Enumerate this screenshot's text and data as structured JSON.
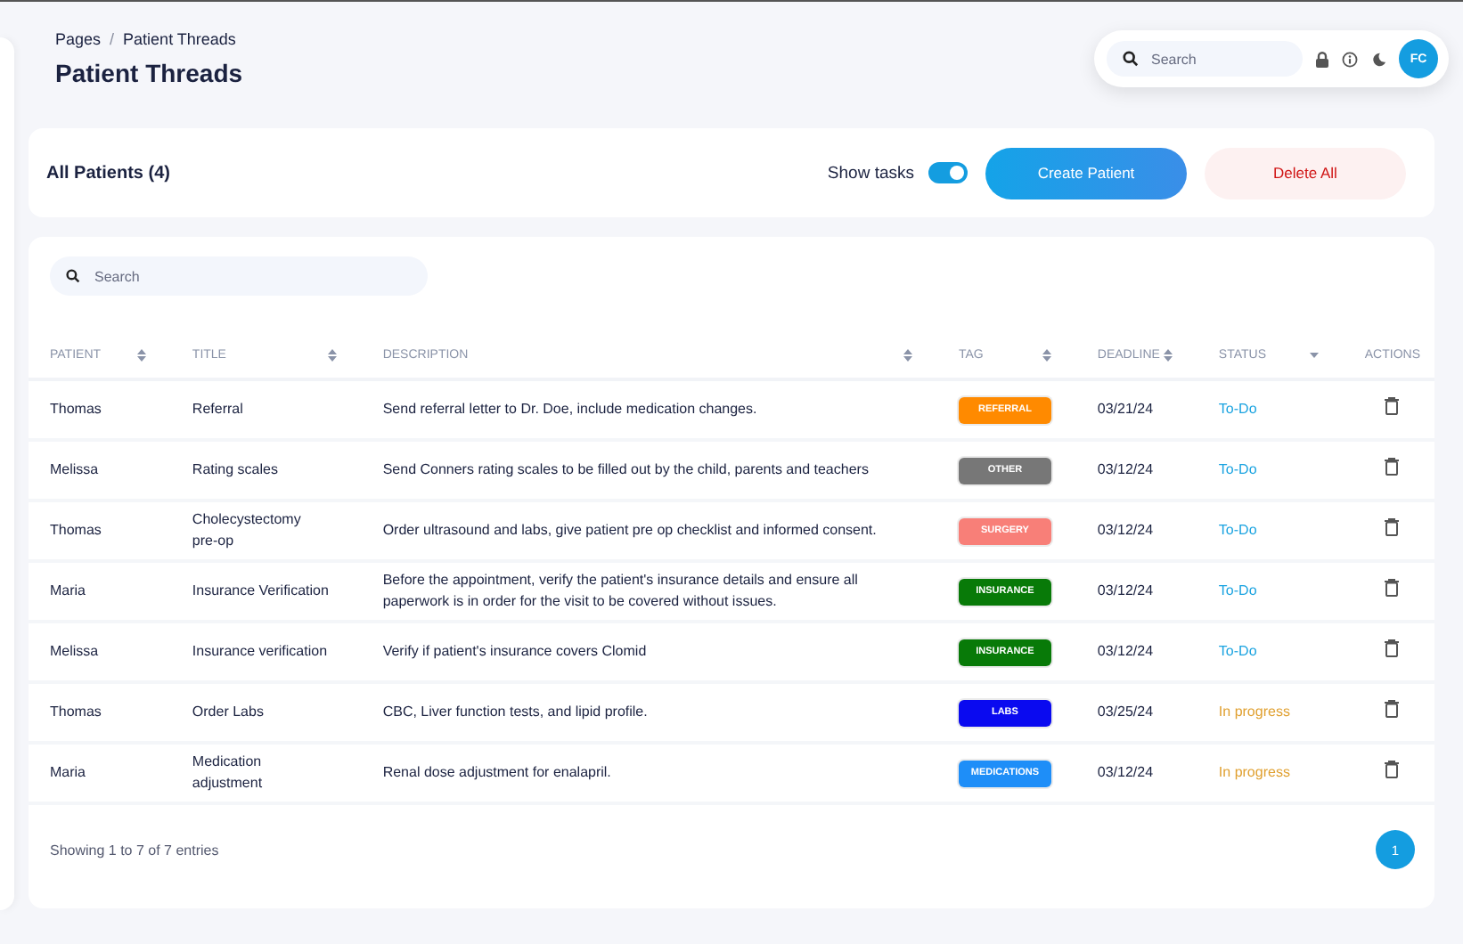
{
  "breadcrumb": [
    {
      "kind": "link",
      "text": "Pages"
    },
    {
      "kind": "separator",
      "text": "/"
    },
    {
      "kind": "link",
      "text": "Patient Threads"
    }
  ],
  "page_title": "Patient Threads",
  "topbar": {
    "search_placeholder": "Search",
    "avatar": "FC"
  },
  "toolbar": {
    "title": "All Patients (4)",
    "toggle_label": "Show tasks",
    "toggle_on": true,
    "create_button": "Create Patient",
    "delete_button": "Delete All"
  },
  "table_search_placeholder": "Search",
  "columns": [
    {
      "label": "PATIENT",
      "kind": "sortable"
    },
    {
      "label": "TITLE",
      "kind": "sortable"
    },
    {
      "label": "DESCRIPTION",
      "kind": "sortable"
    },
    {
      "label": "TAG",
      "kind": "sortable"
    },
    {
      "label": "DEADLINE",
      "kind": "sortable"
    },
    {
      "label": "STATUS",
      "kind": "dropdown"
    },
    {
      "label": "ACTIONS",
      "kind": "plain"
    }
  ],
  "rows": [
    {
      "patient": "Thomas",
      "title": "Referral",
      "description": "Send referral letter to Dr. Doe, include medication changes.",
      "tag": {
        "label": "REFERRAL",
        "color": "#ff8a00"
      },
      "deadline": "03/21/24",
      "status": {
        "text": "To-Do",
        "kind": "todo"
      }
    },
    {
      "patient": "Melissa",
      "title": "Rating scales",
      "description": "Send Conners rating scales to be filled out by the child, parents and teachers",
      "tag": {
        "label": "OTHER",
        "color": "#777777"
      },
      "deadline": "03/12/24",
      "status": {
        "text": "To-Do",
        "kind": "todo"
      }
    },
    {
      "patient": "Thomas",
      "title": "Cholecystectomy pre-op",
      "description": "Order ultrasound and labs, give patient pre op checklist and informed consent.",
      "tag": {
        "label": "SURGERY",
        "color": "#f87f78"
      },
      "deadline": "03/12/24",
      "status": {
        "text": "To-Do",
        "kind": "todo"
      }
    },
    {
      "patient": "Maria",
      "title": "Insurance Verification",
      "description": "Before the appointment, verify the patient's insurance details and ensure all paperwork is in order for the visit to be covered without issues.",
      "tag": {
        "label": "INSURANCE",
        "color": "#087a08"
      },
      "deadline": "03/12/24",
      "status": {
        "text": "To-Do",
        "kind": "todo"
      }
    },
    {
      "patient": "Melissa",
      "title": "Insurance verification",
      "description": "Verify if patient's insurance covers Clomid",
      "tag": {
        "label": "INSURANCE",
        "color": "#087a08"
      },
      "deadline": "03/12/24",
      "status": {
        "text": "To-Do",
        "kind": "todo"
      }
    },
    {
      "patient": "Thomas",
      "title": "Order Labs",
      "description": "CBC, Liver function tests, and lipid profile.",
      "tag": {
        "label": "LABS",
        "color": "#0a0af0"
      },
      "deadline": "03/25/24",
      "status": {
        "text": "In progress",
        "kind": "progress"
      }
    },
    {
      "patient": "Maria",
      "title": "Medication adjustment",
      "description": "Renal dose adjustment for enalapril.",
      "tag": {
        "label": "MEDICATIONS",
        "color": "#1e8ef8"
      },
      "deadline": "03/12/24",
      "status": {
        "text": "In progress",
        "kind": "progress"
      }
    }
  ],
  "footer": {
    "summary": "Showing 1 to 7 of 7 entries",
    "pages": [
      {
        "label": "1",
        "selected": true
      }
    ]
  }
}
